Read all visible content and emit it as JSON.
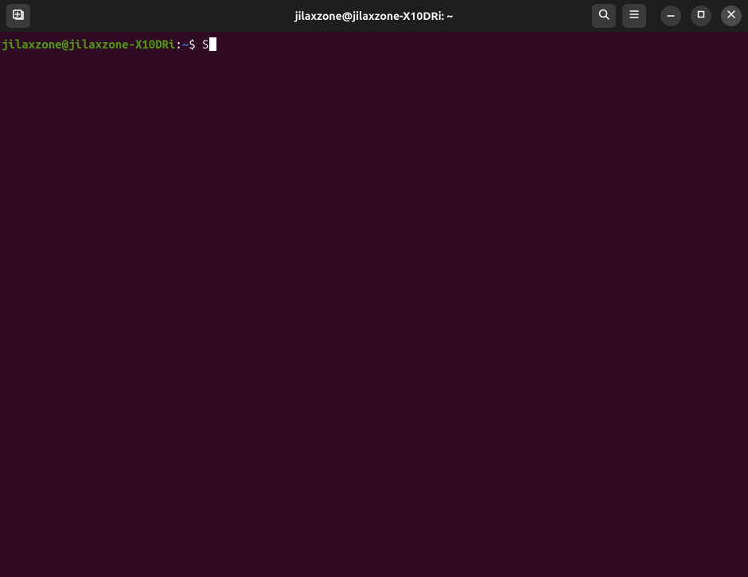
{
  "titlebar": {
    "title": "jilaxzone@jilaxzone-X10DRi: ~"
  },
  "prompt": {
    "user_host": "jilaxzone@jilaxzone-X10DRi",
    "colon": ":",
    "path": "~",
    "dollar": "$",
    "command": "S"
  },
  "icons": {
    "new_tab": "new-tab-icon",
    "search": "search-icon",
    "menu": "hamburger-icon",
    "minimize": "minimize-icon",
    "maximize": "maximize-icon",
    "close": "close-icon"
  }
}
